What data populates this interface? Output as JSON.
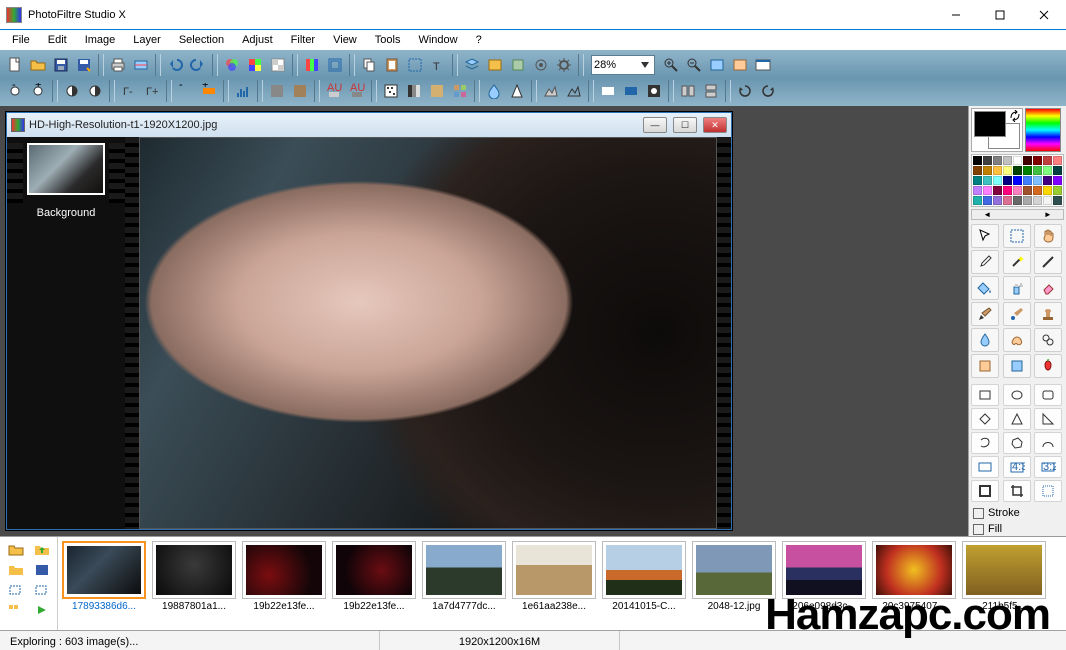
{
  "app": {
    "title": "PhotoFiltre Studio X"
  },
  "menu": [
    "File",
    "Edit",
    "Image",
    "Layer",
    "Selection",
    "Adjust",
    "Filter",
    "View",
    "Tools",
    "Window",
    "?"
  ],
  "zoom": {
    "value": "28%"
  },
  "document": {
    "title": "HD-High-Resolution-t1-1920X1200.jpg",
    "layer_label": "Background"
  },
  "right_panel": {
    "stroke_label": "Stroke",
    "fill_label": "Fill"
  },
  "swatch_colors": [
    "#000000",
    "#404040",
    "#808080",
    "#c0c0c0",
    "#ffffff",
    "#400000",
    "#800000",
    "#c04040",
    "#ff8080",
    "#804000",
    "#c08000",
    "#ffc040",
    "#ffff80",
    "#004000",
    "#008000",
    "#40c040",
    "#80ff80",
    "#004040",
    "#008080",
    "#40c0c0",
    "#80ffff",
    "#000080",
    "#0000ff",
    "#4080ff",
    "#80c0ff",
    "#400080",
    "#8000ff",
    "#c080ff",
    "#ff80ff",
    "#800040",
    "#ff0080",
    "#ff80c0",
    "#a0522d",
    "#d2691e",
    "#ffd700",
    "#9acd32",
    "#20b2aa",
    "#4169e1",
    "#9370db",
    "#db7093",
    "#696969",
    "#a9a9a9",
    "#d3d3d3",
    "#f5f5f5",
    "#2f4f4f"
  ],
  "thumbnails": [
    {
      "name": "17893386d6...",
      "selected": true,
      "bg": "linear-gradient(135deg,#1a2430,#3a4a58 40%,#0c0c0c)"
    },
    {
      "name": "19887801a1...",
      "selected": false,
      "bg": "radial-gradient(circle at 50% 40%,#3a3a3a,#0a0a0a)"
    },
    {
      "name": "19b22e13fe...",
      "selected": false,
      "bg": "radial-gradient(circle at 30% 60%,#7a0d10,#140608 70%)"
    },
    {
      "name": "19b22e13fe...",
      "selected": false,
      "bg": "radial-gradient(circle at 60% 50%,#6a0d12,#100408 70%)"
    },
    {
      "name": "1a7d4777dc...",
      "selected": false,
      "bg": "linear-gradient(#88aacc 0 45%,#2c3a2c 45% 100%)"
    },
    {
      "name": "1e61aa238e...",
      "selected": false,
      "bg": "linear-gradient(#e8e4d8 0 40%,#b89868 40% 100%)"
    },
    {
      "name": "20141015-C...",
      "selected": false,
      "bg": "linear-gradient(#b7cfe5 0 50%,#c96a2b 50% 70%,#203018 70%)"
    },
    {
      "name": "2048-12.jpg",
      "selected": false,
      "bg": "linear-gradient(#8098b8 0 55%,#586838 55%)"
    },
    {
      "name": "206e098d3c...",
      "selected": false,
      "bg": "linear-gradient(#c850a0 0 45%,#2a3060 45% 70%,#101020 70%)"
    },
    {
      "name": "20c3975407...",
      "selected": false,
      "bg": "radial-gradient(circle,#f0c020,#c03020 60%,#401008)"
    },
    {
      "name": "211b5f5...",
      "selected": false,
      "bg": "linear-gradient(#c0a030,#806020)"
    }
  ],
  "status": {
    "exploring": "Exploring : 603 image(s)...",
    "dims": "1920x1200x16M"
  },
  "watermark": "Hamzapc.com"
}
